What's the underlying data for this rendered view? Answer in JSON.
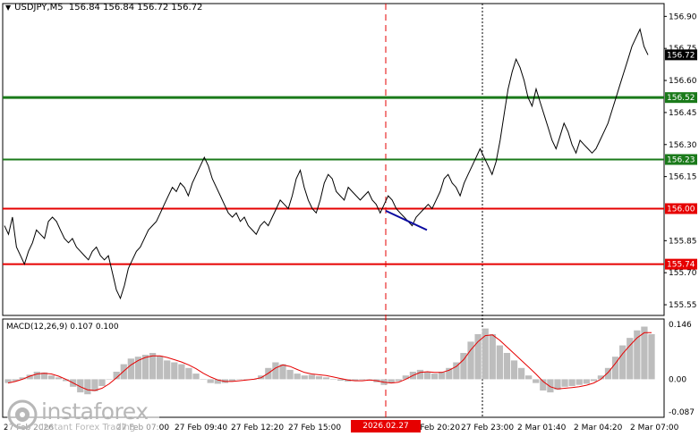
{
  "header": {
    "symbol_tf": "USDJPY,M5",
    "ohlc": "156.84 156.84 156.72 156.72"
  },
  "macd": {
    "label": "MACD(12,26,9) 0.107 0.100",
    "ticks": [
      "0.146",
      "0.00",
      "-0.087"
    ]
  },
  "logo": {
    "name": "instaforex",
    "tagline": "Instant Forex Trading"
  },
  "colors": {
    "price_line": "#000000",
    "support_resistance_green": "#1a7a1a",
    "support_resistance_red": "#e60000",
    "trend_line_blue": "#0a0aa0",
    "macd_hist": "#bdbdbd",
    "macd_signal": "#e60000"
  },
  "chart_data": {
    "type": "line",
    "title": "USDJPY,M5",
    "xlabel": "",
    "ylabel": "",
    "ylim": [
      155.5,
      156.96
    ],
    "y_ticks": [
      "156.90",
      "156.75",
      "156.60",
      "156.45",
      "156.30",
      "156.15",
      "155.85",
      "155.70",
      "155.55"
    ],
    "x_ticks": [
      "27 Feb 2026",
      "27 Feb 07:00",
      "27 Feb 09:40",
      "27 Feb 12:20",
      "27 Feb 15:00",
      "2026.02.27 19:30",
      "27 Feb 20:20",
      "27 Feb 23:00",
      "2 Mar 01:40",
      "2 Mar 04:20",
      "2 Mar 07:00"
    ],
    "highlighted_time": "2026.02.27 19:30",
    "current_price": "156.72",
    "horizontal_levels": [
      {
        "value": 156.52,
        "label": "156.52",
        "color": "green"
      },
      {
        "value": 156.23,
        "label": "156.23",
        "color": "green"
      },
      {
        "value": 156.0,
        "label": "156.00",
        "color": "red"
      },
      {
        "value": 155.74,
        "label": "155.74",
        "color": "red"
      }
    ],
    "series": [
      {
        "values": [
          155.92,
          155.88,
          155.96,
          155.82,
          155.78,
          155.74,
          155.8,
          155.84,
          155.9,
          155.88,
          155.86,
          155.94,
          155.96,
          155.94,
          155.9,
          155.86,
          155.84,
          155.86,
          155.82,
          155.8,
          155.78,
          155.76,
          155.8,
          155.82,
          155.78,
          155.76,
          155.78,
          155.7,
          155.62,
          155.58,
          155.64,
          155.72,
          155.76,
          155.8,
          155.82,
          155.86,
          155.9,
          155.92,
          155.94,
          155.98,
          156.02,
          156.06,
          156.1,
          156.08,
          156.12,
          156.1,
          156.06,
          156.12,
          156.16,
          156.2,
          156.24,
          156.2,
          156.14,
          156.1,
          156.06,
          156.02,
          155.98,
          155.96,
          155.98,
          155.94,
          155.96,
          155.92,
          155.9,
          155.88,
          155.92,
          155.94,
          155.92,
          155.96,
          156.0,
          156.04,
          156.02,
          156.0,
          156.06,
          156.14,
          156.18,
          156.1,
          156.04,
          156.0,
          155.98,
          156.04,
          156.12,
          156.16,
          156.14,
          156.08,
          156.06,
          156.04,
          156.1,
          156.08,
          156.06,
          156.04,
          156.06,
          156.08,
          156.04,
          156.02,
          155.98,
          156.02,
          156.06,
          156.04,
          156.0,
          155.98,
          155.96,
          155.94,
          155.92,
          155.96,
          155.98,
          156.0,
          156.02,
          156.0,
          156.04,
          156.08,
          156.14,
          156.16,
          156.12,
          156.1,
          156.06,
          156.12,
          156.16,
          156.2,
          156.24,
          156.28,
          156.24,
          156.2,
          156.16,
          156.22,
          156.32,
          156.44,
          156.56,
          156.64,
          156.7,
          156.66,
          156.6,
          156.52,
          156.48,
          156.56,
          156.5,
          156.44,
          156.38,
          156.32,
          156.28,
          156.34,
          156.4,
          156.36,
          156.3,
          156.26,
          156.32,
          156.3,
          156.28,
          156.26,
          156.28,
          156.32,
          156.36,
          156.4,
          156.46,
          156.52,
          156.58,
          156.64,
          156.7,
          156.76,
          156.8,
          156.84,
          156.76,
          156.72
        ]
      }
    ],
    "trend_line": {
      "from_time": "2026.02.27 19:30",
      "from": 155.99,
      "to": 155.9
    },
    "macd": {
      "ylim": [
        -0.087,
        0.146
      ],
      "histogram": [
        -0.01,
        -0.005,
        0.005,
        0.012,
        0.02,
        0.018,
        0.01,
        0.005,
        -0.005,
        -0.02,
        -0.035,
        -0.04,
        -0.032,
        -0.018,
        0.0,
        0.02,
        0.04,
        0.055,
        0.06,
        0.065,
        0.07,
        0.062,
        0.05,
        0.045,
        0.04,
        0.03,
        0.015,
        0.0,
        -0.01,
        -0.012,
        -0.01,
        -0.005,
        0.0,
        -0.002,
        0.0,
        0.01,
        0.03,
        0.045,
        0.04,
        0.025,
        0.015,
        0.01,
        0.012,
        0.008,
        0.005,
        0.0,
        -0.004,
        -0.006,
        -0.004,
        -0.002,
        0.0,
        -0.008,
        -0.015,
        -0.01,
        -0.005,
        0.01,
        0.02,
        0.025,
        0.02,
        0.015,
        0.02,
        0.03,
        0.045,
        0.07,
        0.1,
        0.12,
        0.135,
        0.12,
        0.09,
        0.07,
        0.05,
        0.03,
        0.01,
        -0.01,
        -0.03,
        -0.035,
        -0.028,
        -0.02,
        -0.018,
        -0.015,
        -0.012,
        -0.005,
        0.01,
        0.03,
        0.06,
        0.09,
        0.11,
        0.13,
        0.14,
        0.12
      ],
      "signal": [
        -0.01,
        -0.006,
        0.0,
        0.008,
        0.014,
        0.016,
        0.014,
        0.008,
        0.0,
        -0.01,
        -0.02,
        -0.028,
        -0.03,
        -0.024,
        -0.012,
        0.004,
        0.022,
        0.038,
        0.05,
        0.058,
        0.062,
        0.062,
        0.058,
        0.052,
        0.046,
        0.038,
        0.028,
        0.016,
        0.006,
        -0.002,
        -0.006,
        -0.006,
        -0.004,
        -0.002,
        0.0,
        0.004,
        0.016,
        0.03,
        0.038,
        0.034,
        0.026,
        0.018,
        0.014,
        0.012,
        0.01,
        0.006,
        0.002,
        -0.002,
        -0.004,
        -0.004,
        -0.002,
        -0.004,
        -0.008,
        -0.01,
        -0.008,
        0.0,
        0.01,
        0.018,
        0.02,
        0.018,
        0.018,
        0.024,
        0.034,
        0.052,
        0.078,
        0.1,
        0.116,
        0.118,
        0.104,
        0.086,
        0.068,
        0.05,
        0.032,
        0.014,
        -0.006,
        -0.02,
        -0.026,
        -0.024,
        -0.022,
        -0.02,
        -0.016,
        -0.01,
        0.0,
        0.018,
        0.042,
        0.068,
        0.09,
        0.11,
        0.124,
        0.124
      ]
    }
  }
}
